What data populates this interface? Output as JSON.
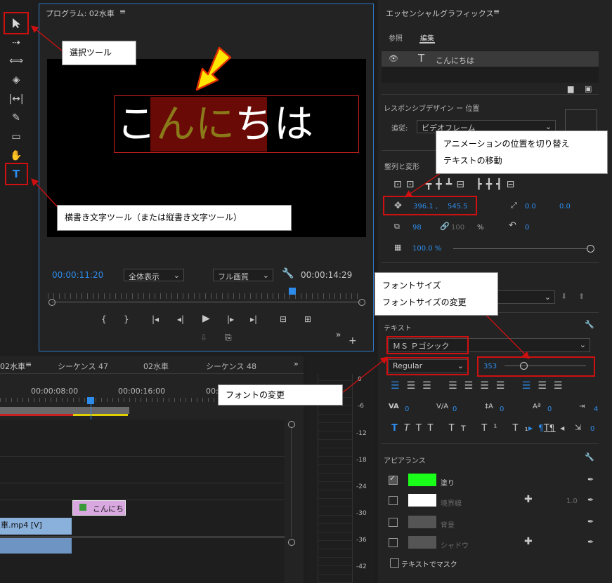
{
  "program": {
    "title": "プログラム: 02水車",
    "timecode_current": "00:00:11:20",
    "timecode_end": "00:00:14:29",
    "zoom": "全体表示",
    "quality": "フル画質",
    "text_chars": [
      "こ",
      "ん",
      "に",
      "ち",
      "は"
    ]
  },
  "timeline": {
    "tab_active": "02水車",
    "tabs": [
      "シーケンス 47",
      "02水車",
      "シーケンス 48"
    ],
    "time1": "00:00:08:00",
    "time2": "00:00:16:00",
    "time3": "00:",
    "clip_text": "こんにち",
    "clip_video": "車.mp4 [V]",
    "meter_ticks": [
      "0",
      "-6",
      "-12",
      "-18",
      "-24",
      "-30",
      "-36",
      "-42"
    ]
  },
  "essential": {
    "title": "エッセンシャルグラフィックス",
    "tab_browse": "参照",
    "tab_edit": "編集",
    "layer_name": "こんにちは",
    "responsive_label": "レスポンシブデザイン ー 位置",
    "follow_label": "追従:",
    "follow_value": "ビデオフレーム",
    "align_label": "整列と変形",
    "pos_x": "396.1",
    "pos_sep": ",",
    "pos_y": "545.5",
    "anchor_x": "0.0",
    "anchor_y": "0.0",
    "scale": "98",
    "scale_h": "100",
    "percent": "%",
    "rotation": "0",
    "opacity": "100.0 %",
    "text_label": "テキスト",
    "font": "ＭＳ Ｐゴシック",
    "style": "Regular",
    "size": "353",
    "tracking_va": "0",
    "kerning": "0",
    "leading": "0",
    "baseline": "0",
    "tsume": "4",
    "tab_w": "0",
    "appearance_label": "アピアランス",
    "fill_label": "塗り",
    "stroke_label": "境界線",
    "stroke_value": "1.0",
    "bg_label": "背景",
    "shadow_label": "シャドウ",
    "mask_label": "テキストでマスク",
    "fill_color": "#1aff1a"
  },
  "callouts": {
    "select_tool": "選択ツール",
    "type_tool": "横書き文字ツール（または縦書き文字ツール）",
    "position": [
      "アニメーションの位置を切り替え",
      "テキストの移動"
    ],
    "font_size": [
      "フォントサイズ",
      "フォントサイズの変更"
    ],
    "font_change": "フォントの変更"
  }
}
